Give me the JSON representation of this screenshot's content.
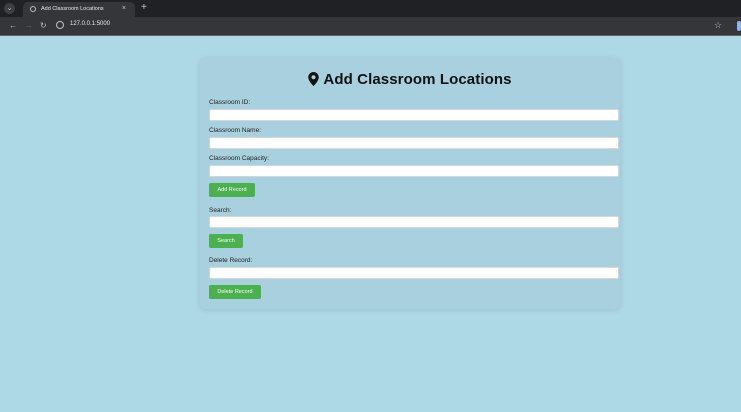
{
  "browser": {
    "tab_title": "Add Classroom Locations",
    "tab_close": "×",
    "new_tab": "+",
    "url": "127.0.0.1:5000"
  },
  "page": {
    "title": "Add Classroom Locations",
    "classroom_id_label": "Classroom ID:",
    "classroom_name_label": "Classroom Name:",
    "classroom_capacity_label": "Classroom Capacity:",
    "add_button": "Add Record",
    "search_label": "Search:",
    "search_button": "Search",
    "delete_label": "Delete Record:",
    "delete_button": "Delete Record",
    "accent_color": "#4caf50",
    "background_color": "#add8e6"
  }
}
